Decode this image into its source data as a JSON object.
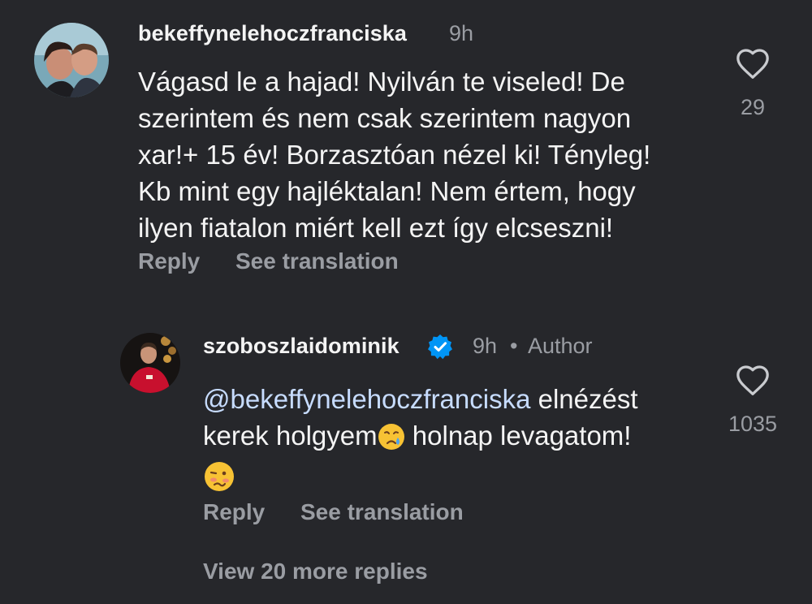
{
  "comment": {
    "username": "bekeffynelehoczfranciska",
    "time": "9h",
    "text_lines": [
      "Vágasd le a hajad! Nyilván te viseled! De",
      "szerintem és nem csak szerintem nagyon",
      "xar!+ 15 év! Borzasztóan nézel ki! Tényleg!",
      "Kb mint egy hajléktalan! Nem értem, hogy",
      "ilyen fiatalon miért kell ezt így elcseszni!"
    ],
    "likes": "29",
    "reply_label": "Reply",
    "translate_label": "See translation"
  },
  "reply": {
    "username": "szoboszlaidominik",
    "time": "9h",
    "separator": "•",
    "author_badge": "Author",
    "verified_icon": "verified-badge-icon",
    "mention": "@bekeffynelehoczfranciska",
    "text_part1": " elnézést",
    "text_part2": "kerek holgyem",
    "emoji1": "crying-face-emoji",
    "text_part3": " holnap levagatom!",
    "emoji2": "woozy-face-emoji",
    "likes": "1035",
    "reply_label": "Reply",
    "translate_label": "See translation"
  },
  "view_more": "View 20 more replies",
  "colors": {
    "background": "#26272b",
    "muted": "#9a9da3",
    "mention": "#c7dcff",
    "verified": "#0095f6"
  }
}
